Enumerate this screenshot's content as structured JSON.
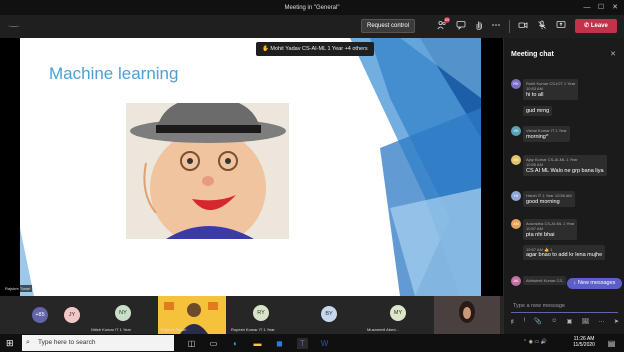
{
  "window": {
    "title": "Meeting in \"General\"",
    "controls": [
      "—",
      "☐",
      "✕"
    ]
  },
  "toolbar": {
    "menu_glyph": "·—·",
    "request_control": "Request control",
    "participants_badge": "85",
    "leave": "Leave"
  },
  "stage": {
    "presenter_tooltip": "Mohit Yadav CS-AI-ML 1 Year +4 others",
    "slide_title": "Machine learning",
    "presenter_name": "Rajshre Tiwari"
  },
  "chat": {
    "title": "Meeting chat",
    "messages": [
      {
        "initials": "RK",
        "sender": "Rohit Kumar CS-IOT 1 Year",
        "time": "10:53 AM",
        "text": "hi to all",
        "extra": "gud mrng",
        "color": "#7a6fc4"
      },
      {
        "initials": "VK",
        "sender": "Vishal Kumar IT 1 Year",
        "time": "10:55 AM",
        "text": "morning^",
        "color": "#5aa2b8"
      },
      {
        "initials": "AK",
        "sender": "Ajay Kumar CS-AI-ML 1 Year",
        "time": "10:55 AM",
        "text": "CS AI ML Walo ne grp bana liya",
        "color": "#e0c36a"
      },
      {
        "initials": "HI",
        "sender": "Harsh IT 1 Year",
        "time": "10:56 AM",
        "text": "good morning",
        "color": "#8fa7d8"
      },
      {
        "initials": "AN",
        "sender": "Anuradha CS-AI-ML 1 Year",
        "time": "10:57 AM",
        "text": "pta nhi bhai",
        "extra_time": "10:57 AM",
        "extra": "agar bnao to add kr lena mujhe",
        "reaction": "👍 1",
        "color": "#e8a25a"
      },
      {
        "initials": "AK",
        "sender": "Abhishek Kumar CS-",
        "time": "",
        "text": "",
        "color": "#c46fa2"
      }
    ],
    "new_messages": "New messages",
    "compose_placeholder": "Type a new message",
    "compose_tools": [
      "Ꞙ",
      "!",
      "📎",
      "☺",
      "▣",
      "🖼",
      "…",
      "➤"
    ]
  },
  "participants": [
    {
      "initials": "+85",
      "name": "",
      "color": "#6264a7"
    },
    {
      "initials": "JY",
      "name": "",
      "color": "#f2c7c7"
    },
    {
      "initials": "NY",
      "name": "Nitish Kumar IT 1 Year",
      "color": "#c8e0c8"
    },
    {
      "initials": "",
      "name": "Rajshre Tiwari",
      "color": "#ffd24a"
    },
    {
      "initials": "RY",
      "name": "Rupesh Kumar IT 1 Year",
      "color": "#d8e4c8"
    },
    {
      "initials": "BY",
      "name": "",
      "color": "#c8d8ec"
    },
    {
      "initials": "MY",
      "name": "Muzammil Abed...",
      "color": "#dde6c8"
    }
  ],
  "taskbar": {
    "search_placeholder": "Type here to search",
    "time": "11:26 AM",
    "date": "11/5/2020"
  }
}
